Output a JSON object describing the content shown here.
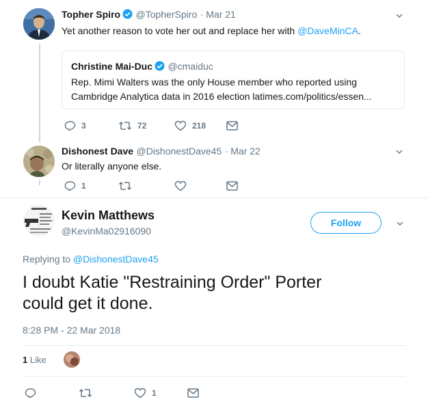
{
  "tweet1": {
    "name": "Topher Spiro",
    "handle": "@TopherSpiro",
    "date": "· Mar 21",
    "text_before": "Yet another reason to vote her out and replace her with ",
    "mention": "@DaveMinCA",
    "text_after": ".",
    "quote": {
      "name": "Christine Mai-Duc",
      "handle": "@cmaiduc",
      "line1": "Rep. Mimi Walters was the only House member who reported using",
      "line2": "Cambridge Analytica data in 2016 election latimes.com/politics/essen..."
    },
    "actions": {
      "replies": "3",
      "retweets": "72",
      "likes": "218"
    }
  },
  "tweet2": {
    "name": "Dishonest Dave",
    "handle": "@DishonestDave45",
    "date": "· Mar 22",
    "text": "Or literally anyone else.",
    "actions": {
      "replies": "1",
      "retweets": "",
      "likes": ""
    }
  },
  "main": {
    "name": "Kevin Matthews",
    "handle": "@KevinMa02916090",
    "follow_label": "Follow",
    "replying_prefix": "Replying to ",
    "replying_to": "@DishonestDave45",
    "text_line1": "I doubt Katie \"Restraining Order\" Porter",
    "text_line2": "could get it done.",
    "timestamp": "8:28 PM - 22 Mar 2018",
    "likes_count": "1",
    "likes_label": " Like",
    "actions": {
      "replies": "",
      "retweets": "",
      "likes": "1"
    }
  },
  "colors": {
    "accent": "#1da1f2",
    "text": "#14171a",
    "muted": "#657786",
    "border": "#e1e8ed"
  }
}
